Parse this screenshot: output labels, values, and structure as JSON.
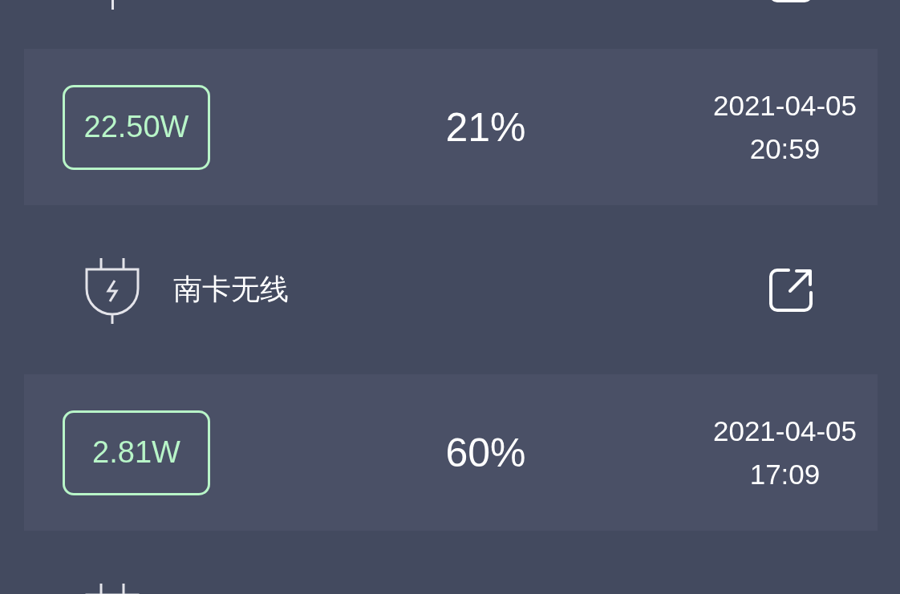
{
  "devices": [
    {
      "power": "22.50W",
      "percent": "21%",
      "date": "2021-04-05",
      "time": "20:59"
    },
    {
      "name": "南卡无线",
      "power": "2.81W",
      "percent": "60%",
      "date": "2021-04-05",
      "time": "17:09"
    }
  ]
}
